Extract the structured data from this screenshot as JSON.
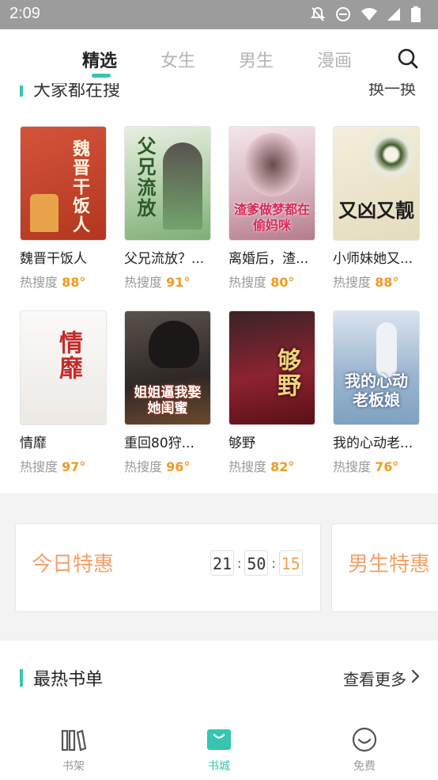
{
  "status_bar": {
    "time": "2:09",
    "icons": [
      "notifications-off-icon",
      "dnd-icon",
      "wifi-icon",
      "signal-icon",
      "battery-icon"
    ]
  },
  "tabs": [
    {
      "label": "精选",
      "active": true
    },
    {
      "label": "女生",
      "active": false
    },
    {
      "label": "男生",
      "active": false
    },
    {
      "label": "漫画",
      "active": false
    }
  ],
  "section_partial": {
    "title": "大家都在搜",
    "action": "换一换"
  },
  "books": [
    {
      "name": "魏晋干饭人",
      "heat_label": "热搜度",
      "heat": "88°",
      "cover_text": "魏晋干饭人",
      "cover_bg": "#c9462c"
    },
    {
      "name": "父兄流放？...",
      "heat_label": "热搜度",
      "heat": "91°",
      "cover_text": "父兄流放",
      "cover_bg": "#b9d6b0"
    },
    {
      "name": "离婚后，渣...",
      "heat_label": "热搜度",
      "heat": "80°",
      "cover_text": "渣爹做梦都在偷妈咪",
      "cover_bg": "#e8d2d8"
    },
    {
      "name": "小师妹她又...",
      "heat_label": "热搜度",
      "heat": "88°",
      "cover_text": "又凶又靓",
      "cover_bg": "#eae4cc"
    },
    {
      "name": "情靡",
      "heat_label": "热搜度",
      "heat": "97°",
      "cover_text": "情靡",
      "cover_bg": "#f4f2f0"
    },
    {
      "name": "重回80狩...",
      "heat_label": "热搜度",
      "heat": "96°",
      "cover_text": "姐姐逼我娶她闺蜜",
      "cover_bg": "#3b3532"
    },
    {
      "name": "够野",
      "heat_label": "热搜度",
      "heat": "82°",
      "cover_text": "够野",
      "cover_bg": "#6a1a22"
    },
    {
      "name": "我的心动老...",
      "heat_label": "热搜度",
      "heat": "76°",
      "cover_text": "我的心动老板娘",
      "cover_bg": "#b8cbe0"
    }
  ],
  "deals": {
    "today_title": "今日特惠",
    "timer": {
      "hours": "21",
      "minutes": "50",
      "seconds": "15"
    },
    "male_title": "男生特惠"
  },
  "hot_lists": {
    "title": "最热书单",
    "more": "查看更多"
  },
  "bottom_nav": [
    {
      "label": "书架",
      "active": false
    },
    {
      "label": "书城",
      "active": true
    },
    {
      "label": "免费",
      "active": false
    }
  ],
  "colors": {
    "accent": "#36c6b0",
    "heat": "#f39a1e",
    "deal": "#f3a167"
  }
}
